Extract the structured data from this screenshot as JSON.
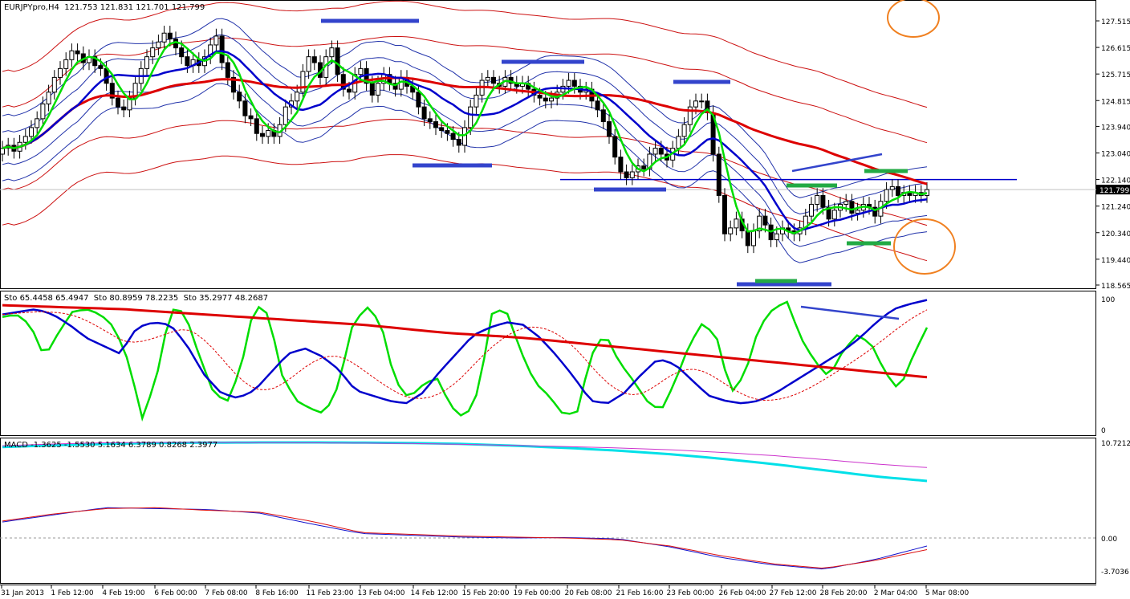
{
  "window": {
    "price_header": "EURJPYpro,H4  121.753 121.831 121.701 121.799",
    "stoch_header": "Sto 65.4458 65.4947  Sto 80.8959 78.2235  Sto 35.2977 48.2687",
    "macd_header": "MACD -1.3625 -1.5530 5.1634 6.3789 0.8268 2.3977"
  },
  "colors": {
    "background": "#ffffff",
    "grid": "#000000",
    "candle_up": "#ffffff",
    "candle_down": "#000000",
    "sma_fast": "#00dd00",
    "sma_mid": "#0000cc",
    "sma_slow": "#dd0000",
    "bands_blue": "#2233aa",
    "bands_red": "#cc1111",
    "annotation_blue": "#3344cc",
    "annotation_green": "#22aa44",
    "annotation_orange": "#f08020",
    "macd_main": "#00e0e8",
    "macd_signal": "#cc33cc",
    "macd_fast": "#1111cc",
    "macd_slow": "#dd1111",
    "current_price_tag_bg": "#000000"
  },
  "chart_data": [
    {
      "type": "candlestick",
      "symbol": "EURJPYpro",
      "timeframe": "H4",
      "ylim": [
        118.565,
        127.515
      ],
      "y_ticks": [
        "127.515",
        "126.615",
        "125.715",
        "124.815",
        "123.940",
        "123.040",
        "122.140",
        "121.240",
        "120.340",
        "119.440",
        "118.565"
      ],
      "current_price": "121.799",
      "x_ticks": [
        "31 Jan 2013",
        "1 Feb 12:00",
        "4 Feb 19:00",
        "6 Feb 00:00",
        "7 Feb 08:00",
        "8 Feb 16:00",
        "11 Feb 23:00",
        "13 Feb 04:00",
        "14 Feb 12:00",
        "15 Feb 20:00",
        "19 Feb 00:00",
        "20 Feb 08:00",
        "21 Feb 16:00",
        "23 Feb 00:00",
        "26 Feb 04:00",
        "27 Feb 12:00",
        "28 Feb 20:00",
        "2 Mar 04:00",
        "5 Mar 08:00"
      ],
      "close": [
        123.2,
        123.3,
        123.1,
        123.4,
        123.6,
        123.9,
        124.2,
        124.7,
        125.1,
        125.6,
        125.9,
        126.2,
        126.5,
        126.4,
        126.1,
        126.3,
        126.0,
        125.9,
        125.4,
        124.9,
        124.6,
        124.5,
        124.9,
        125.4,
        125.9,
        126.3,
        126.6,
        126.8,
        127.1,
        126.9,
        126.6,
        126.3,
        126.0,
        126.2,
        126.0,
        126.3,
        126.7,
        127.0,
        126.1,
        125.6,
        125.1,
        124.8,
        124.3,
        124.2,
        123.7,
        123.6,
        123.8,
        123.6,
        124.0,
        124.6,
        124.8,
        125.1,
        125.8,
        126.3,
        126.1,
        125.6,
        126.3,
        126.6,
        125.7,
        125.2,
        125.1,
        125.7,
        125.9,
        125.4,
        125.0,
        125.4,
        125.7,
        125.4,
        125.2,
        125.6,
        125.3,
        125.1,
        124.6,
        124.2,
        124.1,
        123.9,
        123.8,
        123.7,
        123.5,
        123.3,
        123.9,
        124.6,
        125.0,
        125.5,
        125.6,
        125.4,
        125.3,
        125.6,
        125.4,
        125.3,
        125.4,
        125.2,
        125.0,
        124.9,
        124.8,
        124.9,
        125.1,
        125.3,
        125.5,
        125.3,
        125.1,
        125.2,
        124.8,
        124.5,
        124.1,
        123.6,
        122.9,
        122.4,
        122.2,
        122.4,
        122.6,
        122.5,
        123.0,
        123.2,
        123.0,
        122.8,
        123.2,
        123.6,
        124.0,
        124.6,
        124.8,
        124.8,
        124.4,
        123.0,
        121.6,
        120.3,
        120.5,
        120.8,
        120.4,
        119.9,
        120.4,
        120.9,
        120.6,
        120.1,
        120.3,
        120.5,
        120.4,
        120.3,
        120.5,
        120.9,
        121.3,
        121.6,
        121.2,
        120.8,
        121.1,
        121.3,
        121.4,
        121.0,
        121.1,
        121.3,
        121.2,
        120.9,
        121.4,
        121.8,
        121.9,
        121.6,
        121.7,
        121.6,
        121.7,
        121.6,
        121.8
      ],
      "sma_fast_color": "green",
      "sma_mid_color": "blue",
      "sma_slow_color": "red",
      "horizontal_line": 122.14
    },
    {
      "type": "line",
      "name_header": "Sto",
      "ylim": [
        0,
        100
      ],
      "y_ticks": [
        "100",
        "0"
      ],
      "series": [
        {
          "color": "green",
          "values": [
            86,
            88,
            80,
            55,
            74,
            90,
            92,
            88,
            78,
            52,
            8,
            40,
            92,
            90,
            58,
            30,
            20,
            46,
            96,
            88,
            40,
            22,
            16,
            12,
            34,
            80,
            94,
            82,
            38,
            24,
            34,
            40,
            18,
            8,
            30,
            92,
            90,
            60,
            36,
            26,
            12,
            12,
            56,
            74,
            52,
            38,
            22,
            14,
            36,
            64,
            82,
            70,
            28,
            42,
            78,
            92,
            98,
            70,
            52,
            40,
            60,
            72,
            66,
            44,
            30,
            56,
            78
          ]
        },
        {
          "color": "blue",
          "values": [
            88,
            90,
            92,
            88,
            80,
            70,
            64,
            58,
            78,
            82,
            80,
            64,
            42,
            28,
            24,
            30,
            44,
            58,
            62,
            56,
            46,
            30,
            26,
            22,
            20,
            28,
            44,
            58,
            72,
            78,
            82,
            80,
            70,
            56,
            40,
            22,
            20,
            28,
            42,
            54,
            50,
            38,
            26,
            22,
            20,
            22,
            28,
            36,
            44,
            52,
            60,
            70,
            82,
            92,
            96,
            99
          ]
        },
        {
          "color": "red",
          "values": [
            95,
            94,
            93,
            92,
            90,
            88,
            86,
            84,
            82,
            80,
            77,
            74,
            72,
            70,
            67,
            64,
            61,
            58,
            55,
            52,
            49,
            46,
            43,
            40
          ]
        }
      ]
    },
    {
      "type": "line",
      "name_header": "MACD",
      "y_ticks": [
        "10.7212",
        "0.00",
        "-3.7036"
      ],
      "ylim": [
        -4.5,
        10.7212
      ],
      "series": [
        {
          "color": "cyan",
          "values": [
            10.2,
            10.4,
            10.55,
            10.65,
            10.7,
            10.72,
            10.72,
            10.7,
            10.65,
            10.55,
            10.35,
            10.1,
            9.8,
            9.4,
            8.9,
            8.3,
            7.6,
            6.9,
            6.4
          ]
        },
        {
          "color": "magenta",
          "values": [
            10.35,
            10.55,
            10.68,
            10.72,
            10.72,
            10.7,
            10.68,
            10.65,
            10.6,
            10.5,
            10.38,
            10.25,
            10.1,
            9.9,
            9.6,
            9.25,
            8.8,
            8.3,
            7.9
          ]
        },
        {
          "color": "blue",
          "values": [
            1.8,
            2.6,
            3.4,
            3.3,
            3.2,
            2.8,
            1.6,
            0.5,
            0.3,
            0.1,
            0.0,
            0.05,
            -0.1,
            -1.0,
            -2.2,
            -3.0,
            -3.5,
            -2.4,
            -0.9
          ]
        },
        {
          "color": "red",
          "values": [
            1.9,
            2.7,
            3.3,
            3.4,
            3.1,
            2.9,
            1.9,
            0.6,
            0.4,
            0.2,
            0.1,
            0.0,
            -0.2,
            -0.9,
            -2.0,
            -2.9,
            -3.4,
            -2.5,
            -1.3
          ]
        }
      ]
    }
  ]
}
